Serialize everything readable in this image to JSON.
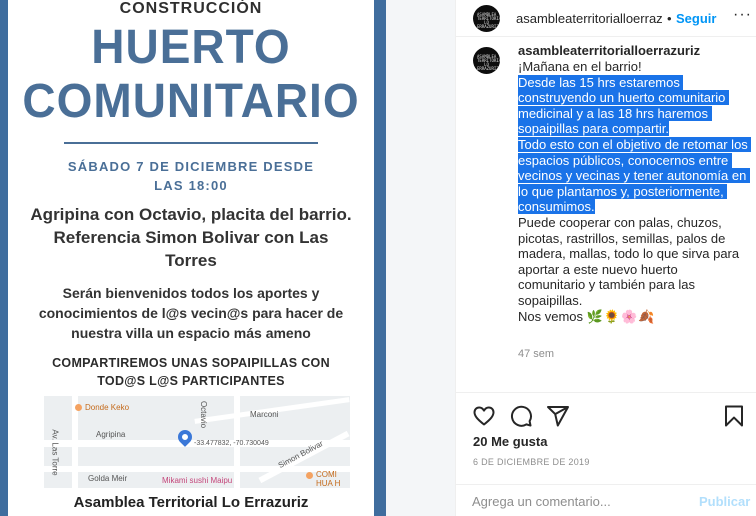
{
  "poster": {
    "kicker": "CONSTRUCCIÓN",
    "title_line1": "HUERTO",
    "title_line2": "COMUNITARIO",
    "date_line1": "SÁBADO 7 DE DICIEMBRE DESDE",
    "date_line2": "LAS 18:00",
    "place": "Agripina con Octavio, placita del barrio. Referencia Simon Bolivar con Las Torres",
    "welcome": "Serán bienvenidos todos los aportes y conocimientos de l@s vecin@s para hacer de nuestra villa un espacio más ameno",
    "share": "COMPARTIREMOS UNAS SOPAIPILLAS CON TOD@S L@S PARTICIPANTES",
    "map": {
      "label_donde": "Donde Keko",
      "label_octavio": "Octavio",
      "label_marconi": "Marconi",
      "label_agripina": "Agripina",
      "label_coords": "-33.477832, -70.730049",
      "label_bolivar": "Simon Bolivar",
      "label_torres": "Av. Las Torre",
      "label_golda": "Golda Meir",
      "label_mikami": "Mikami sushi Maipu",
      "label_comi": "COMI",
      "label_hua": "HUA H"
    },
    "footer": "Asamblea Territorial Lo Errazuriz"
  },
  "header": {
    "avatar_text": "ASAMBLEA TERRITORIAL LO ERRAZURIZ",
    "username": "asambleaterritorialloerraz",
    "dot": "•",
    "follow": "Seguir",
    "more": "···"
  },
  "comment": {
    "username": "asambleaterritorialloerrazuriz",
    "line_intro": "¡Mañana en el barrio!\n",
    "highlighted": "Desde las 15 hrs estaremos construyendo un huerto comunitario medicinal y a las 18 hrs haremos sopaipillas para compartir.\nTodo esto con el objetivo de retomar los espacios públicos, conocernos entre vecinos y vecinas y tener autonomía en lo que plantamos y, posteriormente, consumimos.",
    "rest": "\nPuede cooperar con palas, chuzos, picotas, rastrillos, semillas, palos de madera, mallas, todo lo que sirva para aportar a este nuevo huerto comunitario y también para las sopaipillas.\nNos vemos ",
    "emojis": "🌿🌻🌸🍂",
    "time": "47 sem"
  },
  "actions": {
    "like": "heart-icon",
    "comment": "comment-bubble-icon",
    "share": "paper-plane-icon",
    "save": "bookmark-icon"
  },
  "likes": {
    "count": "20",
    "label": " Me gusta"
  },
  "post_date": "6 DE DICIEMBRE DE 2019",
  "add_comment": {
    "placeholder": "Agrega un comentario...",
    "publish": "Publicar"
  },
  "colors": {
    "poster_blue": "#4a6f97",
    "follow_blue": "#0095f6",
    "selection": "#1a73e8",
    "publish_disabled": "#b2dffc"
  }
}
